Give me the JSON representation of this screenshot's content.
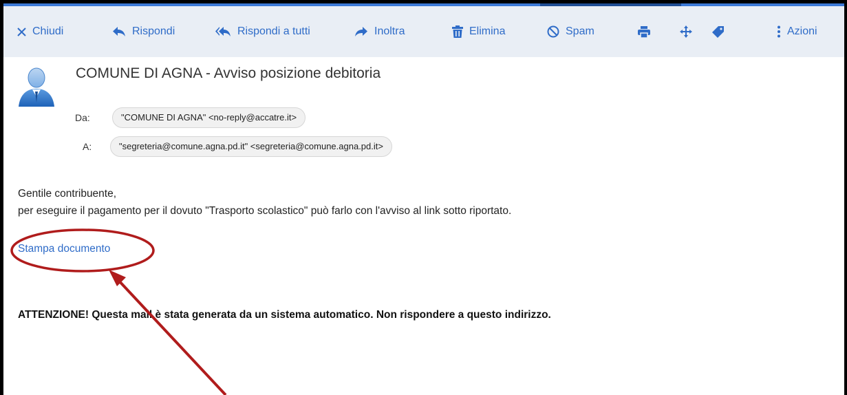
{
  "toolbar": {
    "close_label": "Chiudi",
    "reply_label": "Rispondi",
    "reply_all_label": "Rispondi a tutti",
    "forward_label": "Inoltra",
    "delete_label": "Elimina",
    "spam_label": "Spam",
    "actions_label": "Azioni"
  },
  "email": {
    "subject": "COMUNE DI AGNA - Avviso posizione debitoria",
    "from_label": "Da:",
    "from_value": "\"COMUNE DI AGNA\" <no-reply@accatre.it>",
    "to_label": "A:",
    "to_value": "\"segreteria@comune.agna.pd.it\" <segreteria@comune.agna.pd.it>",
    "greeting": "Gentile contribuente,",
    "body_line": "per eseguire il pagamento per il dovuto \"Trasporto scolastico\" può farlo con l'avviso al link sotto riportato.",
    "link_text": "Stampa documento",
    "warning": "ATTENZIONE! Questa mail è stata generata da un sistema automatico. Non rispondere a questo indirizzo."
  },
  "colors": {
    "accent": "#2f6cc8",
    "toolbar_bg": "#e9eef5",
    "annotation": "#b01c1c"
  }
}
